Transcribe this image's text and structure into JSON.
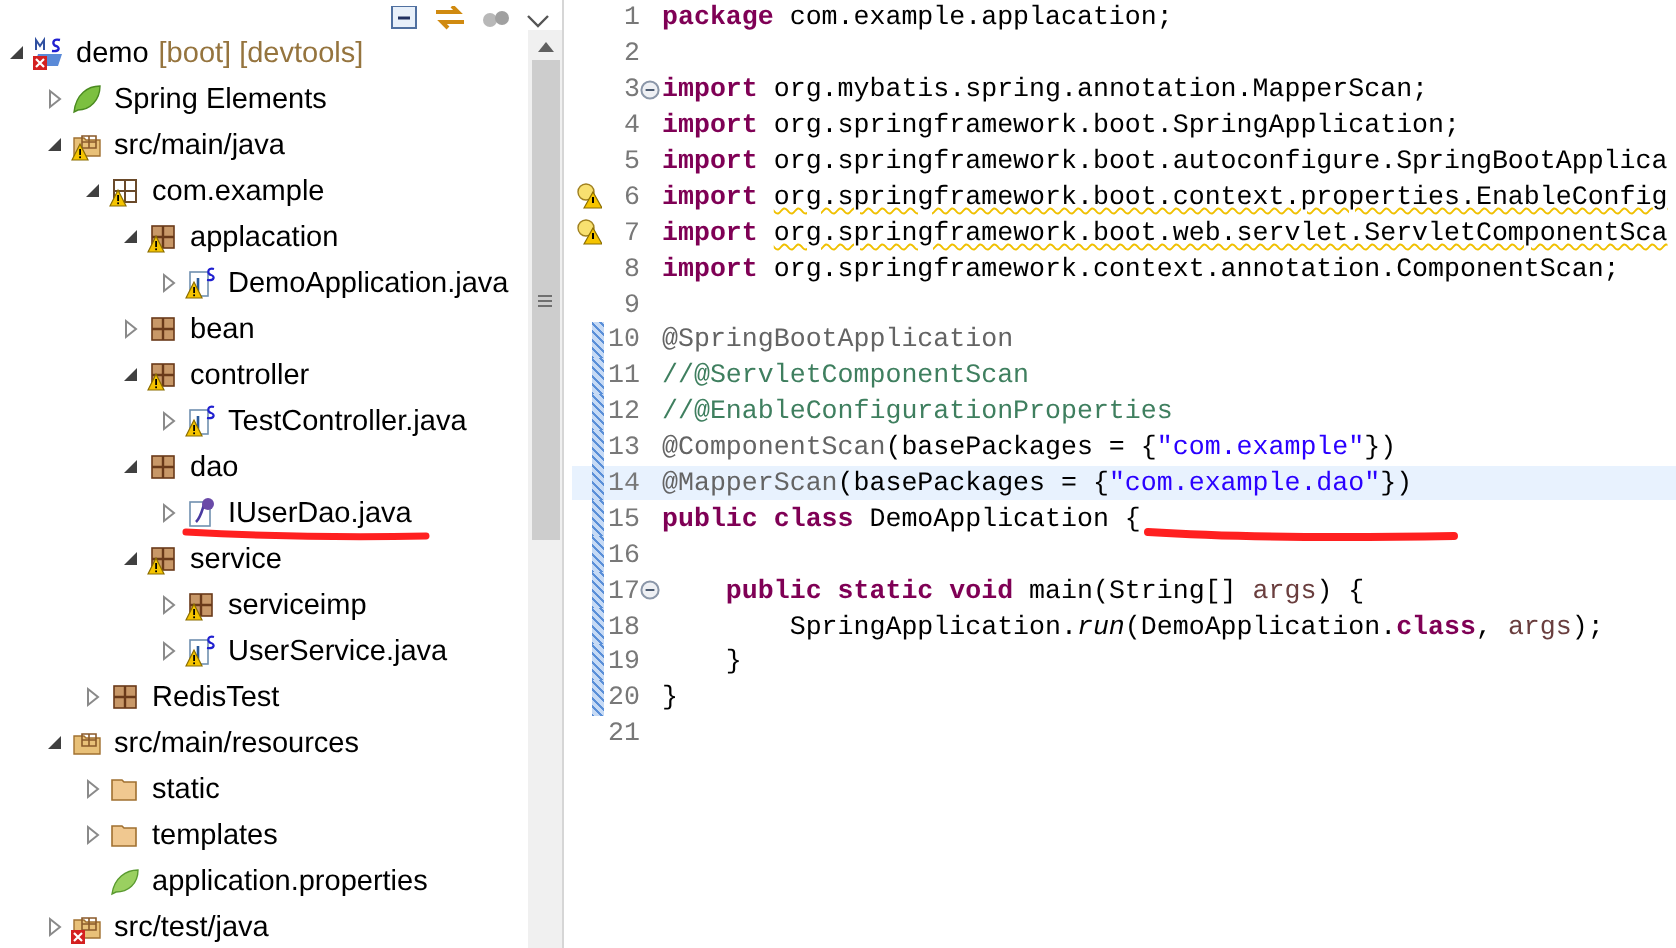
{
  "explorer": {
    "tree": [
      {
        "label": "demo",
        "decoration": "[boot] [devtools]",
        "kind": "project",
        "warning": false,
        "error": true,
        "expanded": true,
        "marked": false,
        "children": [
          {
            "label": "Spring Elements",
            "kind": "spring",
            "warning": false,
            "error": false,
            "expanded": false,
            "marked": false
          },
          {
            "label": "src/main/java",
            "kind": "source-folder",
            "warning": true,
            "error": false,
            "expanded": true,
            "marked": false,
            "children": [
              {
                "label": "com.example",
                "kind": "package-empty",
                "warning": true,
                "error": false,
                "expanded": true,
                "marked": false,
                "children": [
                  {
                    "label": "applacation",
                    "kind": "package",
                    "warning": true,
                    "error": false,
                    "expanded": true,
                    "marked": false,
                    "children": [
                      {
                        "label": "DemoApplication.java",
                        "kind": "class",
                        "warning": true,
                        "error": false,
                        "expanded": false,
                        "marked": false
                      }
                    ]
                  },
                  {
                    "label": "bean",
                    "kind": "package",
                    "warning": false,
                    "error": false,
                    "expanded": false,
                    "marked": false
                  },
                  {
                    "label": "controller",
                    "kind": "package",
                    "warning": true,
                    "error": false,
                    "expanded": true,
                    "marked": false,
                    "children": [
                      {
                        "label": "TestController.java",
                        "kind": "class",
                        "warning": true,
                        "error": false,
                        "expanded": false,
                        "marked": false
                      }
                    ]
                  },
                  {
                    "label": "dao",
                    "kind": "package",
                    "warning": false,
                    "error": false,
                    "expanded": true,
                    "marked": false,
                    "children": [
                      {
                        "label": "IUserDao.java",
                        "kind": "interface",
                        "warning": false,
                        "error": false,
                        "expanded": false,
                        "marked": true
                      }
                    ]
                  },
                  {
                    "label": "service",
                    "kind": "package",
                    "warning": true,
                    "error": false,
                    "expanded": true,
                    "marked": false,
                    "children": [
                      {
                        "label": "serviceimp",
                        "kind": "package",
                        "warning": true,
                        "error": false,
                        "expanded": false,
                        "marked": false
                      },
                      {
                        "label": "UserService.java",
                        "kind": "class",
                        "warning": true,
                        "error": false,
                        "expanded": false,
                        "marked": false
                      }
                    ]
                  }
                ]
              },
              {
                "label": "RedisTest",
                "kind": "package",
                "warning": false,
                "error": false,
                "expanded": false,
                "marked": false
              }
            ]
          },
          {
            "label": "src/main/resources",
            "kind": "source-folder",
            "warning": false,
            "error": false,
            "expanded": true,
            "marked": false,
            "children": [
              {
                "label": "static",
                "kind": "folder",
                "warning": false,
                "error": false,
                "expanded": false,
                "marked": false
              },
              {
                "label": "templates",
                "kind": "folder",
                "warning": false,
                "error": false,
                "expanded": false,
                "marked": false
              },
              {
                "label": "application.properties",
                "kind": "properties",
                "warning": false,
                "error": false,
                "marked": false
              }
            ]
          },
          {
            "label": "src/test/java",
            "kind": "source-folder",
            "warning": false,
            "error": true,
            "expanded": false,
            "marked": false
          }
        ]
      }
    ]
  },
  "editor": {
    "lines": [
      {
        "number": "1",
        "fold": false,
        "warning": false,
        "changed": false,
        "current": false,
        "marked": false,
        "tokens": [
          {
            "kind": "keyword",
            "text": "package"
          },
          {
            "kind": "plain",
            "text": " com.example.applacation;"
          }
        ]
      },
      {
        "number": "2",
        "fold": false,
        "warning": false,
        "changed": false,
        "current": false,
        "marked": false
      },
      {
        "number": "3",
        "fold": true,
        "warning": false,
        "changed": false,
        "current": false,
        "marked": false,
        "tokens": [
          {
            "kind": "keyword",
            "text": "import"
          },
          {
            "kind": "plain",
            "text": " org.mybatis.spring.annotation.MapperScan;"
          }
        ]
      },
      {
        "number": "4",
        "fold": false,
        "warning": false,
        "changed": false,
        "current": false,
        "marked": false,
        "tokens": [
          {
            "kind": "keyword",
            "text": "import"
          },
          {
            "kind": "plain",
            "text": " org.springframework.boot.SpringApplication;"
          }
        ]
      },
      {
        "number": "5",
        "fold": false,
        "warning": false,
        "changed": false,
        "current": false,
        "marked": false,
        "tokens": [
          {
            "kind": "keyword",
            "text": "import"
          },
          {
            "kind": "plain",
            "text": " org.springframework.boot.autoconfigure.SpringBootApplica"
          }
        ]
      },
      {
        "number": "6",
        "fold": false,
        "warning": true,
        "changed": false,
        "current": false,
        "marked": false,
        "tokens": [
          {
            "kind": "keyword",
            "text": "import"
          },
          {
            "kind": "unused",
            "text": " org.springframework.boot.context.properties.EnableConfig"
          }
        ]
      },
      {
        "number": "7",
        "fold": false,
        "warning": true,
        "changed": false,
        "current": false,
        "marked": false,
        "tokens": [
          {
            "kind": "keyword",
            "text": "import"
          },
          {
            "kind": "unused",
            "text": " org.springframework.boot.web.servlet.ServletComponentSca"
          }
        ]
      },
      {
        "number": "8",
        "fold": false,
        "warning": false,
        "changed": false,
        "current": false,
        "marked": false,
        "tokens": [
          {
            "kind": "keyword",
            "text": "import"
          },
          {
            "kind": "plain",
            "text": " org.springframework.context.annotation.ComponentScan;"
          }
        ]
      },
      {
        "number": "9",
        "fold": false,
        "warning": false,
        "changed": false,
        "current": false,
        "marked": false
      },
      {
        "number": "10",
        "fold": false,
        "warning": false,
        "changed": true,
        "current": false,
        "marked": false,
        "tokens": [
          {
            "kind": "annotation",
            "text": "@SpringBootApplication"
          }
        ]
      },
      {
        "number": "11",
        "fold": false,
        "warning": false,
        "changed": true,
        "current": false,
        "marked": false,
        "tokens": [
          {
            "kind": "comment",
            "text": "//@ServletComponentScan"
          }
        ]
      },
      {
        "number": "12",
        "fold": false,
        "warning": false,
        "changed": true,
        "current": false,
        "marked": false,
        "tokens": [
          {
            "kind": "comment",
            "text": "//@EnableConfigurationProperties"
          }
        ]
      },
      {
        "number": "13",
        "fold": false,
        "warning": false,
        "changed": true,
        "current": false,
        "marked": false,
        "tokens": [
          {
            "kind": "annotation",
            "text": "@ComponentScan"
          },
          {
            "kind": "plain",
            "text": "(basePackages = {"
          },
          {
            "kind": "string",
            "text": "\"com.example\""
          },
          {
            "kind": "plain",
            "text": "})"
          }
        ]
      },
      {
        "number": "14",
        "fold": false,
        "warning": false,
        "changed": true,
        "current": true,
        "marked": false,
        "tokens": [
          {
            "kind": "annotation",
            "text": "@MapperScan"
          },
          {
            "kind": "plain",
            "text": "(basePackages = {"
          },
          {
            "kind": "string",
            "text": "\"com.example.dao\""
          },
          {
            "kind": "plain",
            "text": "})"
          }
        ]
      },
      {
        "number": "15",
        "fold": false,
        "warning": false,
        "changed": true,
        "current": false,
        "marked": true,
        "tokens": [
          {
            "kind": "keyword",
            "text": "public class"
          },
          {
            "kind": "plain",
            "text": " DemoApplication {"
          }
        ]
      },
      {
        "number": "16",
        "fold": false,
        "warning": false,
        "changed": true,
        "current": false,
        "marked": false
      },
      {
        "number": "17",
        "fold": true,
        "warning": false,
        "changed": true,
        "current": false,
        "marked": false,
        "tokens": [
          {
            "kind": "keyword",
            "text": "    public static void"
          },
          {
            "kind": "plain",
            "text": " main(String[] "
          },
          {
            "kind": "variable",
            "text": "args"
          },
          {
            "kind": "plain",
            "text": ") {"
          }
        ]
      },
      {
        "number": "18",
        "fold": false,
        "warning": false,
        "changed": true,
        "current": false,
        "marked": false,
        "tokens": [
          {
            "kind": "plain",
            "text": "        SpringApplication."
          },
          {
            "kind": "static",
            "text": "run"
          },
          {
            "kind": "plain",
            "text": "(DemoApplication."
          },
          {
            "kind": "keyword",
            "text": "class"
          },
          {
            "kind": "plain",
            "text": ", "
          },
          {
            "kind": "variable",
            "text": "args"
          },
          {
            "kind": "plain",
            "text": ");"
          }
        ]
      },
      {
        "number": "19",
        "fold": false,
        "warning": false,
        "changed": true,
        "current": false,
        "marked": false,
        "tokens": [
          {
            "kind": "plain",
            "text": "    }"
          }
        ]
      },
      {
        "number": "20",
        "fold": false,
        "warning": false,
        "changed": true,
        "current": false,
        "marked": false,
        "tokens": [
          {
            "kind": "plain",
            "text": "}"
          }
        ]
      },
      {
        "number": "21",
        "fold": false,
        "warning": false,
        "changed": false,
        "current": false,
        "marked": false
      }
    ]
  }
}
